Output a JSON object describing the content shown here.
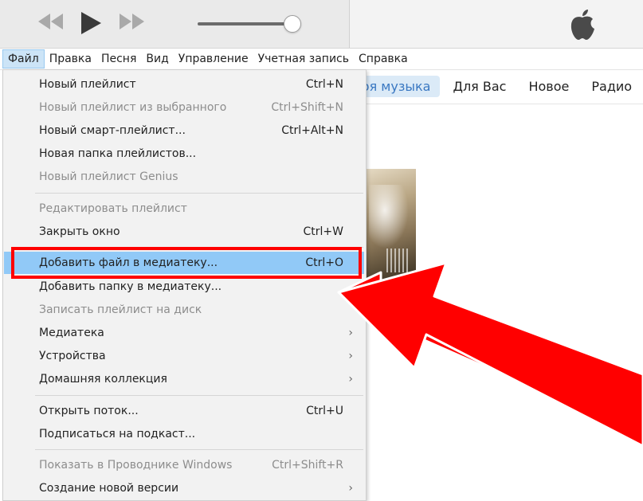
{
  "menubar": {
    "items": [
      "Файл",
      "Правка",
      "Песня",
      "Вид",
      "Управление",
      "Учетная запись",
      "Справка"
    ]
  },
  "tabs": [
    "Моя музыка",
    "Для Вас",
    "Новое",
    "Радио"
  ],
  "file_menu": {
    "items": [
      {
        "label": "Новый плейлист",
        "shortcut": "Ctrl+N"
      },
      {
        "label": "Новый плейлист из выбранного",
        "shortcut": "Ctrl+Shift+N"
      },
      {
        "label": "Новый смарт-плейлист...",
        "shortcut": "Ctrl+Alt+N"
      },
      {
        "label": "Новая папка плейлистов...",
        "shortcut": ""
      },
      {
        "label": "Новый плейлист Genius",
        "shortcut": ""
      },
      {
        "label": "Редактировать плейлист",
        "shortcut": ""
      },
      {
        "label": "Закрыть окно",
        "shortcut": "Ctrl+W"
      },
      {
        "label": "Добавить файл в медиатеку...",
        "shortcut": "Ctrl+O"
      },
      {
        "label": "Добавить папку в медиатеку...",
        "shortcut": ""
      },
      {
        "label": "Записать плейлист на диск",
        "shortcut": ""
      },
      {
        "label": "Медиатека",
        "shortcut": ""
      },
      {
        "label": "Устройства",
        "shortcut": ""
      },
      {
        "label": "Домашняя коллекция",
        "shortcut": ""
      },
      {
        "label": "Открыть поток...",
        "shortcut": "Ctrl+U"
      },
      {
        "label": "Подписаться на подкаст...",
        "shortcut": ""
      },
      {
        "label": "Показать в Проводнике Windows",
        "shortcut": "Ctrl+Shift+R"
      },
      {
        "label": "Создание новой версии",
        "shortcut": ""
      }
    ]
  },
  "colors": {
    "highlight": "#91c9f7",
    "annotation": "#ff0000",
    "tab_selected": "#3a78c2"
  },
  "icons": {
    "previous": "rewind-icon",
    "play": "play-icon",
    "next": "fast-forward-icon",
    "brand": "apple-logo-icon"
  },
  "volume_level": 0.92
}
